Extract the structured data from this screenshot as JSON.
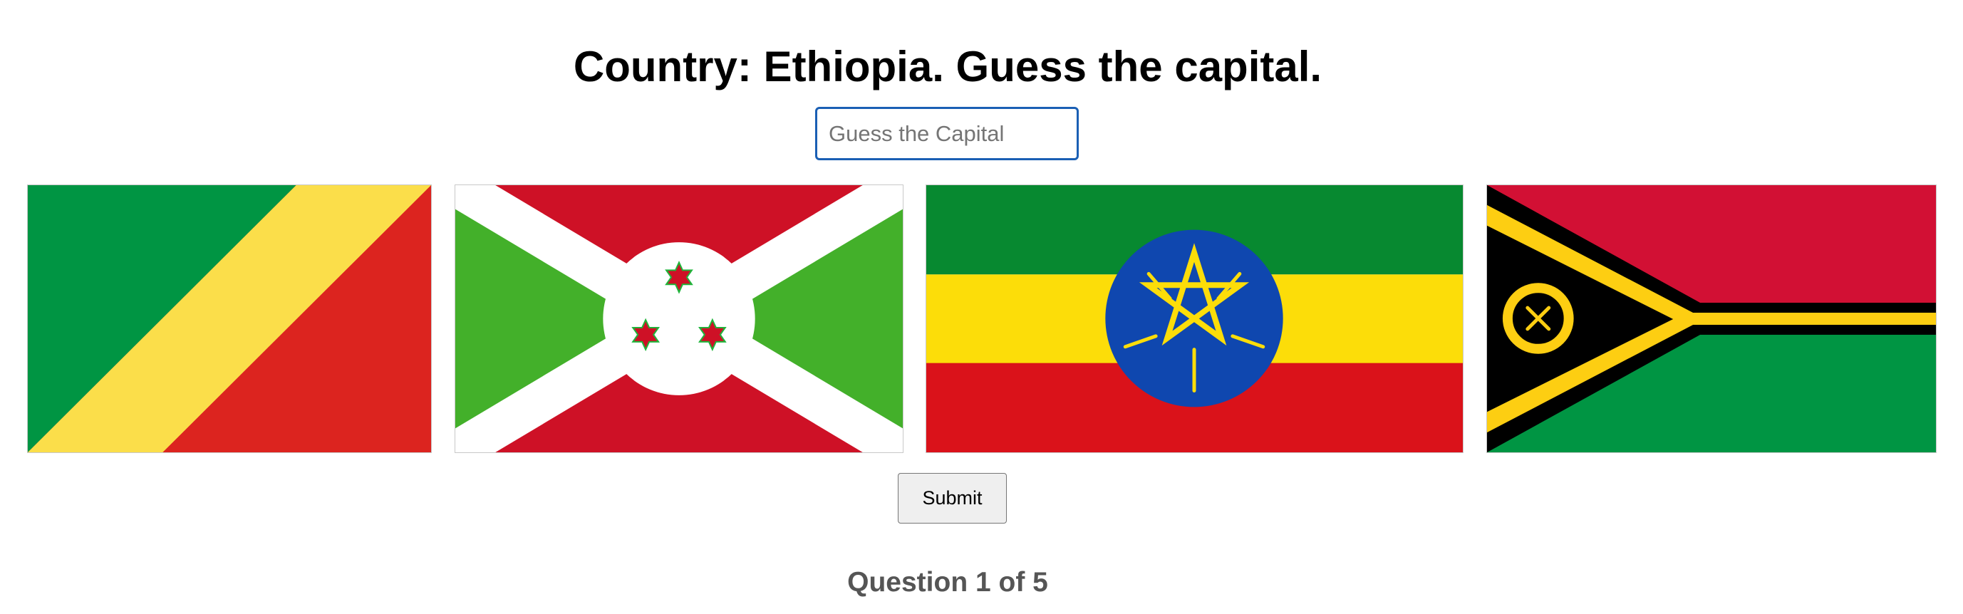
{
  "quiz": {
    "title": "Country: Ethiopia. Guess the capital.",
    "input_placeholder": "Guess the Capital",
    "input_value": "",
    "submit_label": "Submit",
    "progress": "Question 1 of 5"
  },
  "flags": [
    {
      "icon": "republic-of-the-congo-flag-icon"
    },
    {
      "icon": "burundi-flag-icon"
    },
    {
      "icon": "ethiopia-flag-icon"
    },
    {
      "icon": "vanuatu-flag-icon"
    }
  ],
  "colors": {
    "input_border": "#1a5fb4",
    "progress_text": "#555555",
    "button_bg": "#efefef"
  }
}
